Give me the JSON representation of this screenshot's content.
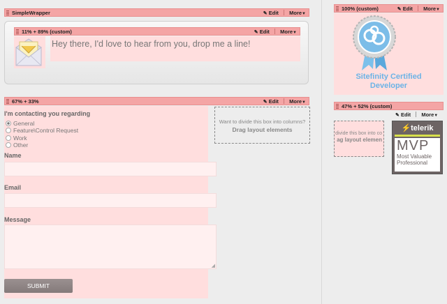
{
  "controls": {
    "edit": "Edit",
    "more": "More"
  },
  "simple_wrapper": {
    "title": "SimpleWrapper"
  },
  "inner_bar": {
    "title": "11% + 89% (custom)"
  },
  "greeting": "Hey there, I'd love to hear from you, drop me a line!",
  "form_section": {
    "title": "67% + 33%"
  },
  "form": {
    "contact_label": "I'm contacting you regarding",
    "options": [
      "General",
      "Feature\\Control Request",
      "Work",
      "Other"
    ],
    "selected": "General",
    "name_label": "Name",
    "email_label": "Email",
    "message_label": "Message",
    "submit_label": "SUBMIT"
  },
  "drop_box": {
    "hint": "Want to divide this box into columns?",
    "action": "Drag layout elements"
  },
  "right_top": {
    "title": "100% (custom)"
  },
  "badge": {
    "text_line1": "Sitefinity Certified",
    "text_line2": "Developer"
  },
  "right_bottom": {
    "title": "47% + 52% (custom)"
  },
  "drop_box_small": {
    "hint": "divide this box into co",
    "action": "ag layout elemen"
  },
  "mvp": {
    "brand": "telerik",
    "big": "MVP",
    "line1": "Most Valuable",
    "line2": "Professional"
  },
  "colors": {
    "accent_bar": "#f4a5a5",
    "pink_bg": "#ffdede",
    "badge_blue": "#6bb3e6"
  }
}
